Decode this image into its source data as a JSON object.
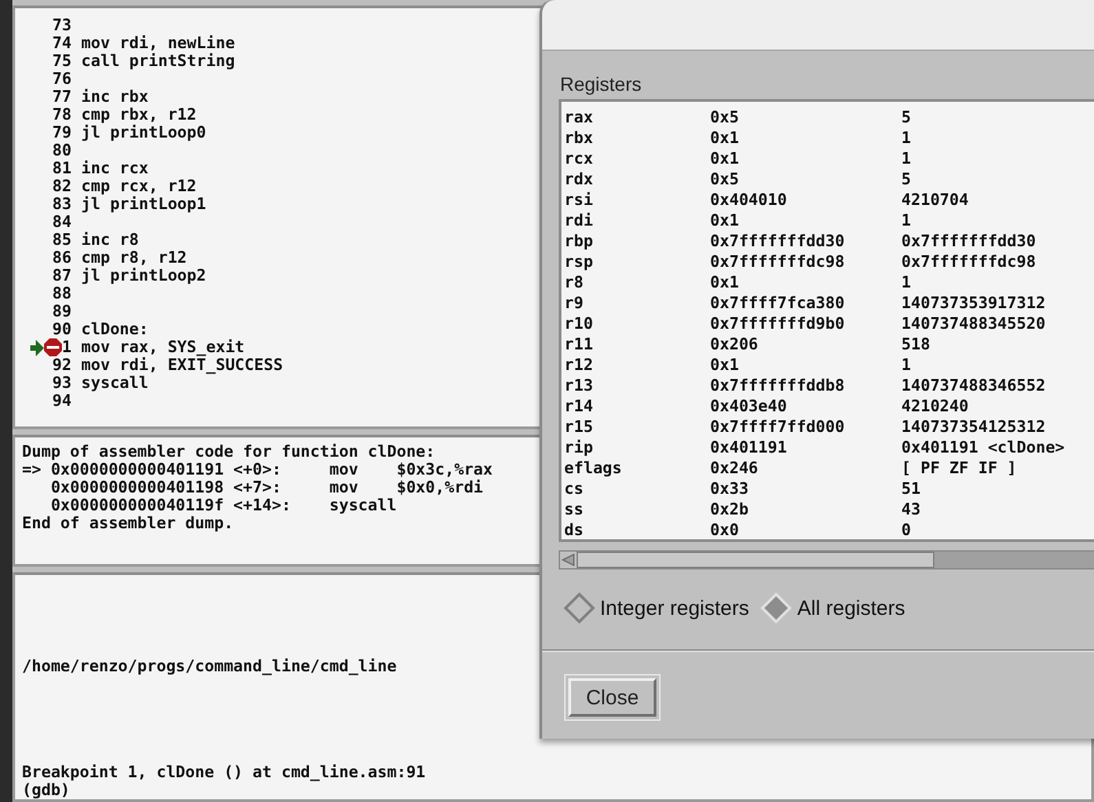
{
  "source_pane": {
    "lines": [
      {
        "number": "73",
        "breakpoint": false,
        "current": false
      },
      {
        "number": "74",
        "code": "mov rdi, newLine",
        "breakpoint": false,
        "current": false
      },
      {
        "number": "75",
        "code": "call printString",
        "breakpoint": false,
        "current": false
      },
      {
        "number": "76",
        "breakpoint": false,
        "current": false
      },
      {
        "number": "77",
        "code": "inc rbx",
        "breakpoint": false,
        "current": false
      },
      {
        "number": "78",
        "code": "cmp rbx, r12",
        "breakpoint": false,
        "current": false
      },
      {
        "number": "79",
        "code": "jl printLoop0",
        "breakpoint": false,
        "current": false
      },
      {
        "number": "80",
        "breakpoint": false,
        "current": false
      },
      {
        "number": "81",
        "code": "inc rcx",
        "breakpoint": false,
        "current": false
      },
      {
        "number": "82",
        "code": "cmp rcx, r12",
        "breakpoint": false,
        "current": false
      },
      {
        "number": "83",
        "code": "jl printLoop1",
        "breakpoint": false,
        "current": false
      },
      {
        "number": "84",
        "breakpoint": false,
        "current": false
      },
      {
        "number": "85",
        "code": "inc r8",
        "breakpoint": false,
        "current": false
      },
      {
        "number": "86",
        "code": "cmp r8, r12",
        "breakpoint": false,
        "current": false
      },
      {
        "number": "87",
        "code": "jl printLoop2",
        "breakpoint": false,
        "current": false
      },
      {
        "number": "88",
        "breakpoint": false,
        "current": false
      },
      {
        "number": "89",
        "breakpoint": false,
        "current": false
      },
      {
        "number": "90",
        "code": "clDone:",
        "breakpoint": false,
        "current": false
      },
      {
        "number": "1",
        "code": "mov rax, SYS_exit",
        "breakpoint": true,
        "current": true
      },
      {
        "number": "92",
        "code": "mov rdi, EXIT_SUCCESS",
        "breakpoint": false,
        "current": false
      },
      {
        "number": "93",
        "code": "syscall",
        "breakpoint": false,
        "current": false
      },
      {
        "number": "94",
        "breakpoint": false,
        "current": false
      }
    ]
  },
  "disassembly_pane": {
    "lines": [
      "Dump of assembler code for function clDone:",
      "=> 0x0000000000401191 <+0>:     mov    $0x3c,%rax",
      "   0x0000000000401198 <+7>:     mov    $0x0,%rdi",
      "   0x000000000040119f <+14>:    syscall",
      "End of assembler dump."
    ]
  },
  "console_pane": {
    "lines": [
      {
        "kind": "output",
        "text": "/home/renzo/progs/command_line/cmd_line"
      },
      {
        "kind": "output",
        "text": "Breakpoint 1, clDone () at cmd_line.asm:91"
      },
      {
        "kind": "prompt",
        "text": "(gdb)"
      }
    ]
  },
  "registers_dialog": {
    "title": "Registers",
    "registers": [
      {
        "name": "rax",
        "hex": "0x5",
        "natural": "5"
      },
      {
        "name": "rbx",
        "hex": "0x1",
        "natural": "1"
      },
      {
        "name": "rcx",
        "hex": "0x1",
        "natural": "1"
      },
      {
        "name": "rdx",
        "hex": "0x5",
        "natural": "5"
      },
      {
        "name": "rsi",
        "hex": "0x404010",
        "natural": "4210704"
      },
      {
        "name": "rdi",
        "hex": "0x1",
        "natural": "1"
      },
      {
        "name": "rbp",
        "hex": "0x7fffffffdd30",
        "natural": "0x7fffffffdd30"
      },
      {
        "name": "rsp",
        "hex": "0x7fffffffdc98",
        "natural": "0x7fffffffdc98"
      },
      {
        "name": "r8",
        "hex": "0x1",
        "natural": "1"
      },
      {
        "name": "r9",
        "hex": "0x7ffff7fca380",
        "natural": "140737353917312"
      },
      {
        "name": "r10",
        "hex": "0x7fffffffd9b0",
        "natural": "140737488345520"
      },
      {
        "name": "r11",
        "hex": "0x206",
        "natural": "518"
      },
      {
        "name": "r12",
        "hex": "0x1",
        "natural": "1"
      },
      {
        "name": "r13",
        "hex": "0x7fffffffddb8",
        "natural": "140737488346552"
      },
      {
        "name": "r14",
        "hex": "0x403e40",
        "natural": "4210240"
      },
      {
        "name": "r15",
        "hex": "0x7ffff7ffd000",
        "natural": "140737354125312"
      },
      {
        "name": "rip",
        "hex": "0x401191",
        "natural": "0x401191 <clDone>"
      },
      {
        "name": "eflags",
        "hex": "0x246",
        "natural": "[ PF ZF IF ]"
      },
      {
        "name": "cs",
        "hex": "0x33",
        "natural": "51"
      },
      {
        "name": "ss",
        "hex": "0x2b",
        "natural": "43"
      },
      {
        "name": "ds",
        "hex": "0x0",
        "natural": "0"
      }
    ],
    "options": [
      {
        "label": "Integer registers",
        "selected": false
      },
      {
        "label": "All registers",
        "selected": true
      }
    ],
    "close_button": "Close"
  }
}
